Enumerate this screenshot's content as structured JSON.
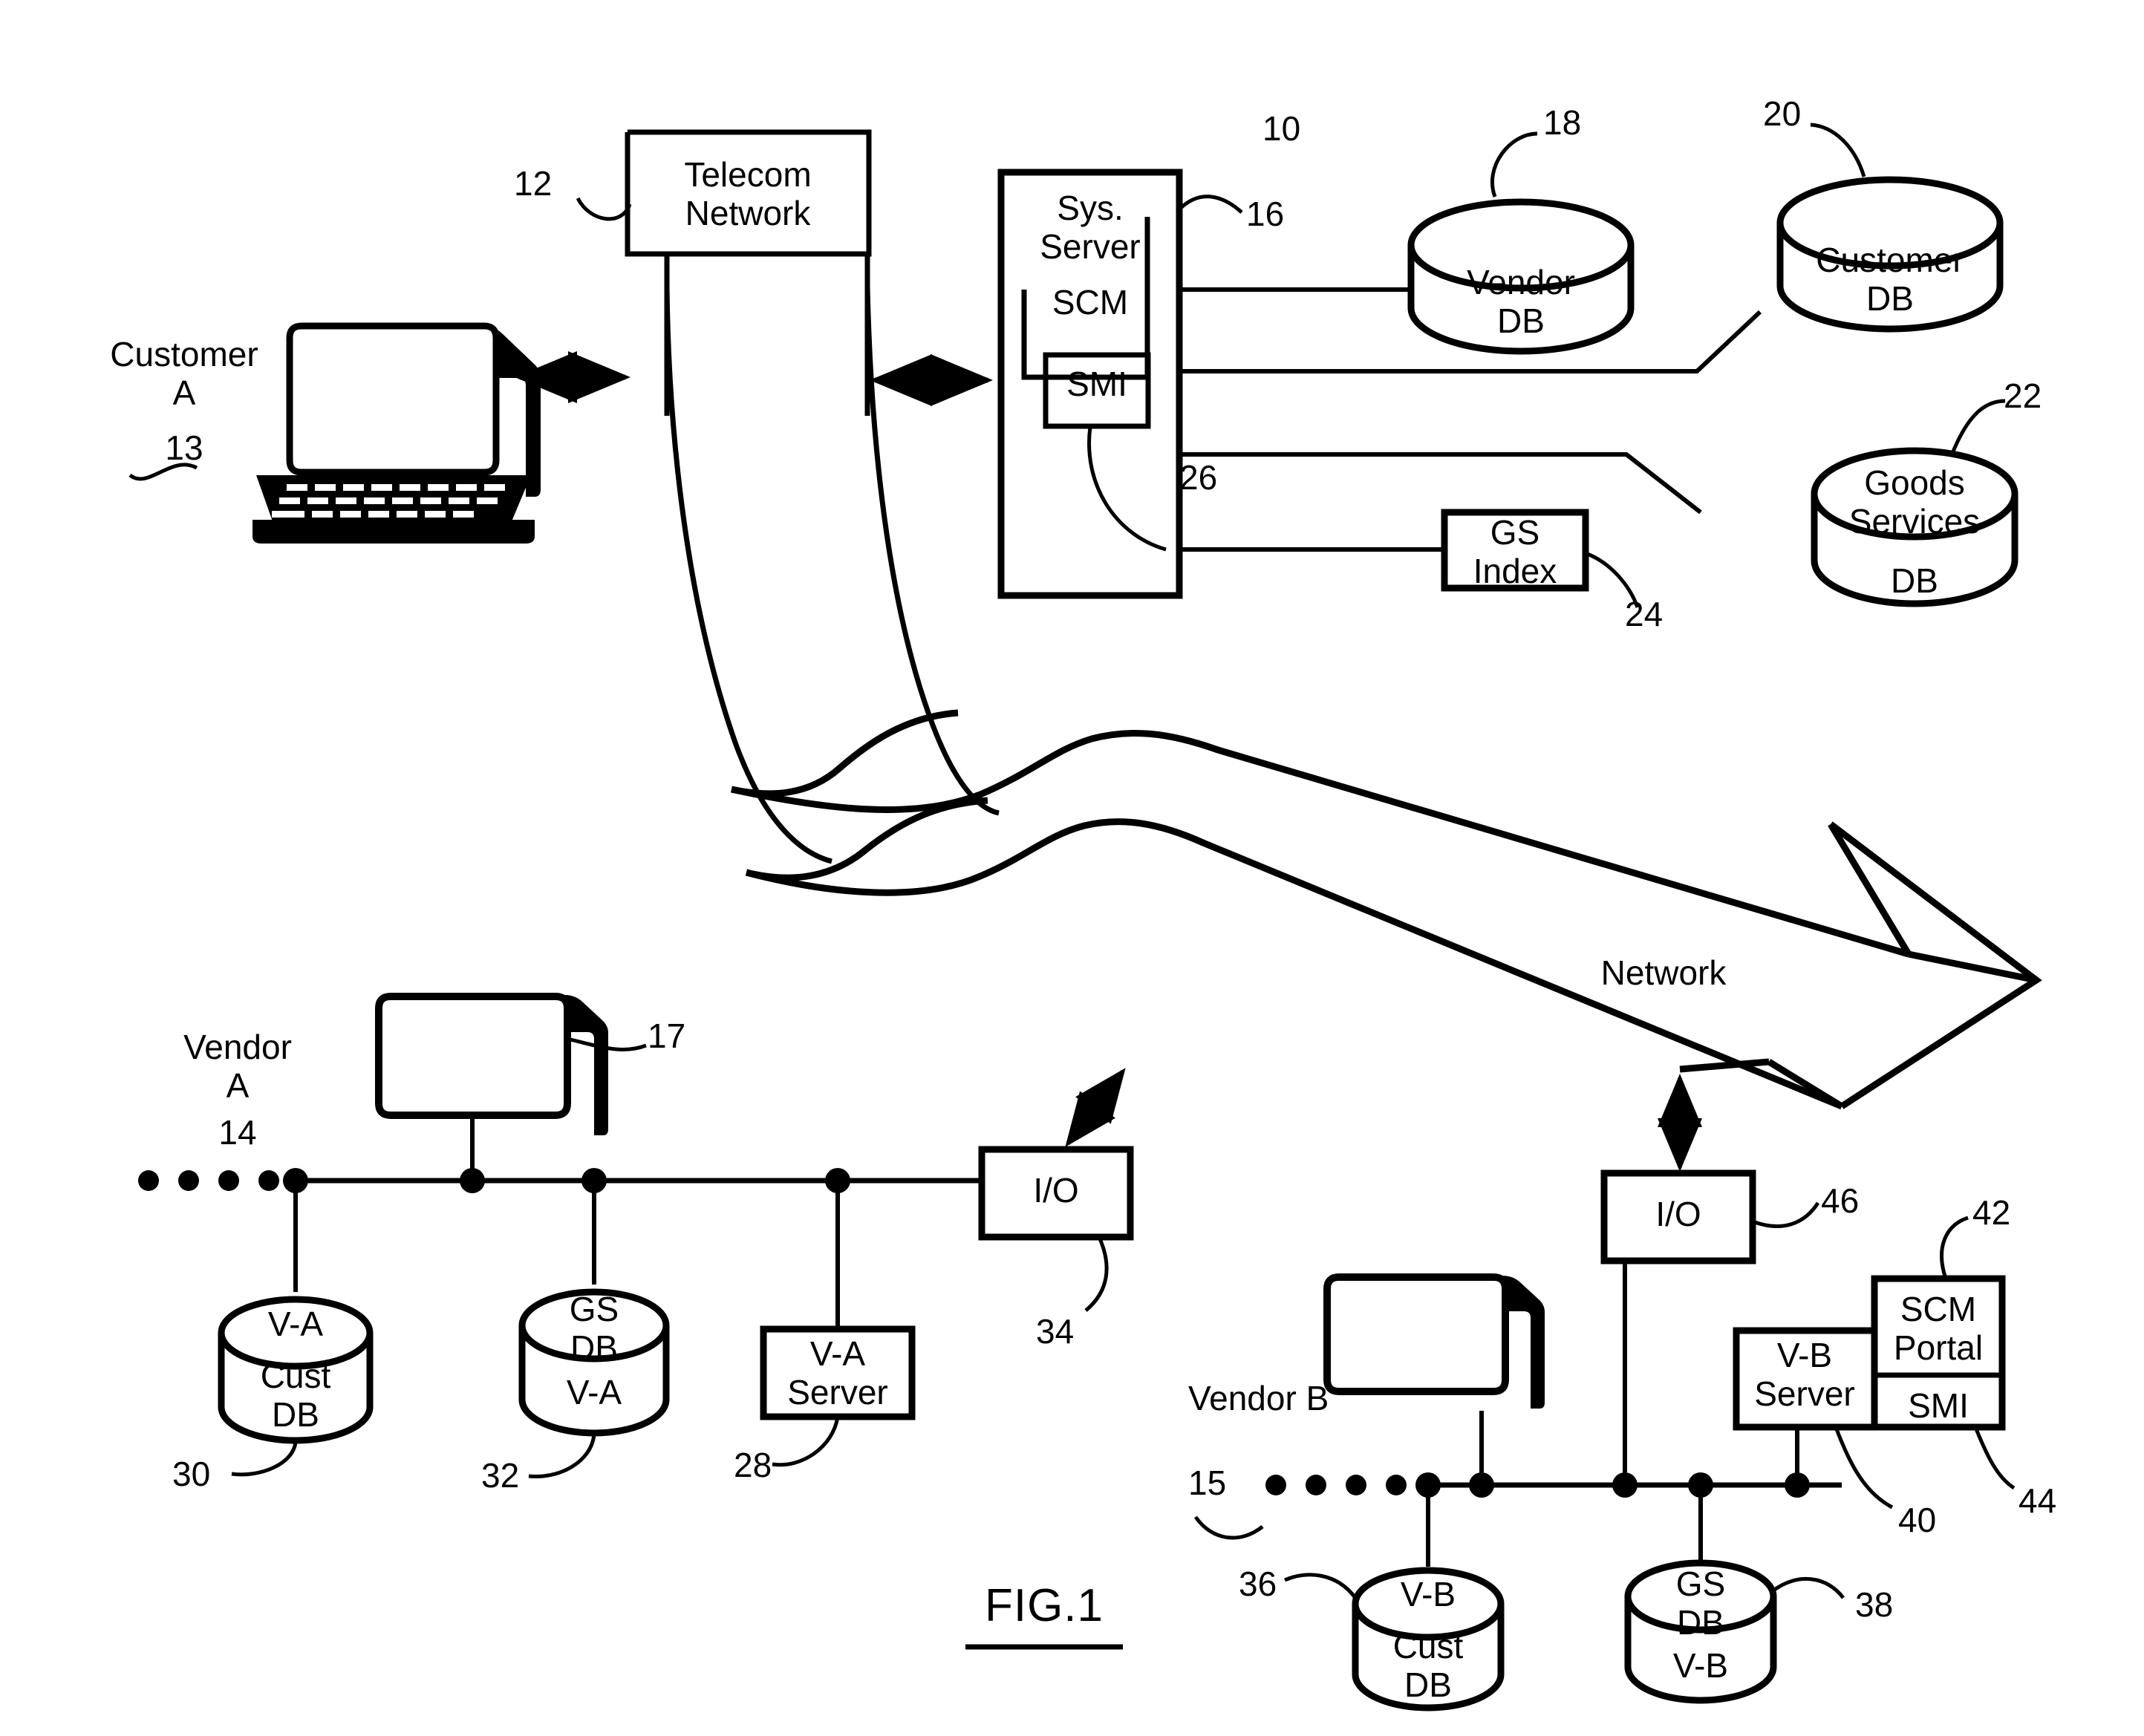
{
  "figure": {
    "title": "FIG.1",
    "network_label": "Network"
  },
  "nodes": {
    "telecom_network": {
      "label": "Telecom\nNetwork",
      "ref": "12"
    },
    "customer_a": {
      "label": "Customer\nA",
      "ref": "13"
    },
    "sys_server": {
      "label": "Sys.\nServer",
      "ref": "16",
      "system_ref": "10"
    },
    "scm": {
      "label": "SCM"
    },
    "smi": {
      "label": "SMI",
      "ref": "26"
    },
    "vendor_db": {
      "label": "Vendor\nDB",
      "ref": "18"
    },
    "customer_db": {
      "label": "Customer\nDB",
      "ref": "20"
    },
    "goods_services_db": {
      "label_top": "Goods\nServices",
      "label_bottom": "DB",
      "ref": "22"
    },
    "gs_index": {
      "label": "GS\nIndex",
      "ref": "24"
    },
    "vendor_a": {
      "label": "Vendor\nA",
      "ref": "14"
    },
    "vendor_a_terminal": {
      "ref": "17"
    },
    "va_cust_db": {
      "label_top": "V-A",
      "label_bottom": "Cust\nDB",
      "ref": "30"
    },
    "va_gs_db": {
      "label_top": "GS\nDB",
      "label_bottom": "V-A",
      "ref": "32"
    },
    "va_server": {
      "label": "V-A\nServer",
      "ref": "28"
    },
    "va_io": {
      "label": "I/O",
      "ref": "34"
    },
    "vendor_b": {
      "label": "Vendor B",
      "ref": "15"
    },
    "vb_cust_db": {
      "label_top": "V-B",
      "label_bottom": "Cust\nDB",
      "ref": "36"
    },
    "vb_gs_db": {
      "label_top": "GS\nDB",
      "label_bottom": "V-B",
      "ref": "38"
    },
    "vb_server": {
      "label": "V-B\nServer",
      "ref": "40"
    },
    "vb_io": {
      "label": "I/O",
      "ref": "46"
    },
    "scm_portal": {
      "label": "SCM\nPortal",
      "ref": "42"
    },
    "vb_smi": {
      "label": "SMI",
      "ref": "44"
    }
  },
  "colors": {
    "stroke": "#000000",
    "background": "#ffffff"
  }
}
